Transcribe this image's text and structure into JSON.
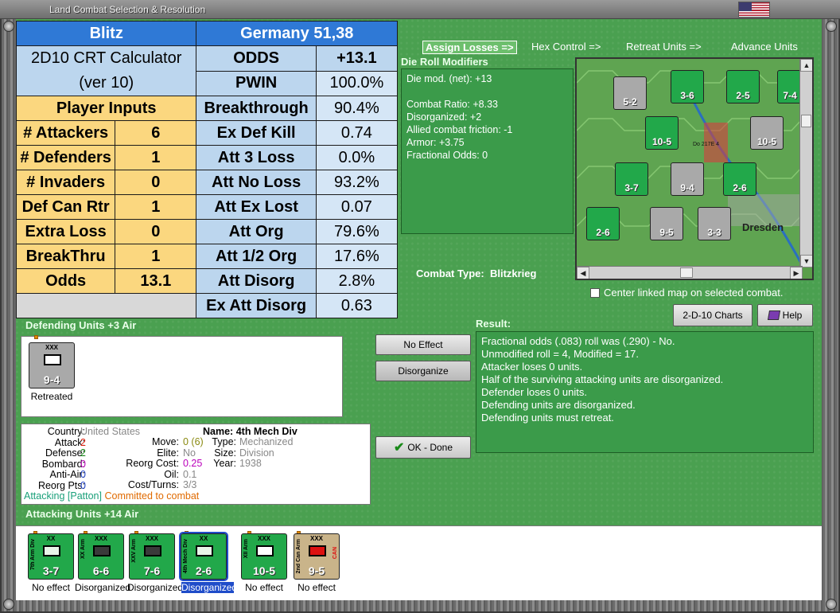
{
  "window": {
    "title": "Land Combat Selection & Resolution"
  },
  "calc": {
    "title": "Blitz",
    "location": "Germany 51,38",
    "calculator_line1": "2D10 CRT Calculator",
    "calculator_line2": "(ver 10)",
    "player_inputs": "Player Inputs",
    "inputs": [
      {
        "label": "# Attackers",
        "value": "6"
      },
      {
        "label": "# Defenders",
        "value": "1"
      },
      {
        "label": "# Invaders",
        "value": "0"
      },
      {
        "label": "Def Can Rtr",
        "value": "1"
      },
      {
        "label": "Extra Loss",
        "value": "0"
      },
      {
        "label": "BreakThru",
        "value": "1"
      },
      {
        "label": "Odds",
        "value": "13.1"
      }
    ],
    "results": [
      {
        "label": "ODDS",
        "value": "+13.1"
      },
      {
        "label": "PWIN",
        "value": "100.0%"
      },
      {
        "label": "Breakthrough",
        "value": "90.4%"
      },
      {
        "label": "Ex Def Kill",
        "value": "0.74"
      },
      {
        "label": "Att 3 Loss",
        "value": "0.0%"
      },
      {
        "label": "Att No Loss",
        "value": "93.2%"
      },
      {
        "label": "Att Ex Lost",
        "value": "0.07"
      },
      {
        "label": "Att Org",
        "value": "79.6%"
      },
      {
        "label": "Att 1/2 Org",
        "value": "17.6%"
      },
      {
        "label": "Att Disorg",
        "value": "2.8%"
      },
      {
        "label": "Ex Att Disorg",
        "value": "0.63"
      }
    ]
  },
  "nav": {
    "assign_losses": "Assign Losses =>",
    "hex_control": "Hex Control =>",
    "retreat_units": "Retreat Units =>",
    "advance_units": "Advance Units"
  },
  "die_roll": {
    "header": "Die Roll Modifiers",
    "lines": [
      "Die mod. (net): +13",
      "",
      "Combat Ratio: +8.33",
      "Disorganized: +2",
      "Allied combat friction: -1",
      "Armor: +3.75",
      "Fractional Odds: 0"
    ]
  },
  "map": {
    "city_label": "Dresden",
    "units": [
      {
        "strength": "5-2",
        "color": "#a9a9a9"
      },
      {
        "strength": "3-6",
        "color": "#22a84a"
      },
      {
        "strength": "2-5",
        "color": "#22a84a"
      },
      {
        "strength": "7-4",
        "color": "#22a84a"
      },
      {
        "strength": "10-5",
        "color": "#22a84a"
      },
      {
        "strength": "10-5",
        "color": "#a9a9a9"
      },
      {
        "strength": "3-7",
        "color": "#22a84a"
      },
      {
        "strength": "9-4",
        "color": "#a9a9a9"
      },
      {
        "strength": "2-6",
        "color": "#22a84a"
      },
      {
        "strength": "2-6",
        "color": "#22a84a"
      },
      {
        "strength": "9-5",
        "color": "#a9a9a9"
      },
      {
        "strength": "3-3",
        "color": "#a9a9a9"
      }
    ],
    "aircraft_label": "Do 217E 4"
  },
  "combat_type": {
    "label": "Combat Type:",
    "value": "Blitzkrieg"
  },
  "center_linked": "Center linked map on selected combat.",
  "buttons": {
    "charts": "2-D-10 Charts",
    "help": "Help",
    "no_effect": "No Effect",
    "disorganize": "Disorganize",
    "ok_done": "OK - Done"
  },
  "defending": {
    "header": "Defending Units +3 Air",
    "units": [
      {
        "strength": "9-4",
        "caption": "Retreated",
        "size": "XXX"
      }
    ]
  },
  "result": {
    "header": "Result:",
    "lines": [
      "Fractional odds (.083) roll was (.290)  - No.",
      "Unmodified roll = 4, Modified = 17.",
      "Attacker loses 0 units.",
      "Half of the surviving attacking units are disorganized.",
      "Defender loses 0 units.",
      "Defending units are disorganized.",
      "Defending units must retreat."
    ]
  },
  "unit_info": {
    "country_label": "Country:",
    "country": "United States",
    "attack_label": "Attack:",
    "attack": "2",
    "defense_label": "Defense:",
    "defense": "2",
    "bombard_label": "Bombard:",
    "bombard": "0",
    "antiair_label": "Anti-Air:",
    "antiair": "0",
    "reorg_label": "Reorg Pts:",
    "reorg": "0",
    "name_label": "Name:",
    "name": "4th Mech Div",
    "move_label": "Move:",
    "move": "0 (6)",
    "type_label": "Type:",
    "type": "Mechanized",
    "elite_label": "Elite:",
    "elite": "No",
    "size_label": "Size:",
    "size": "Division",
    "reorgcost_label": "Reorg Cost:",
    "reorgcost": "0.25",
    "year_label": "Year:",
    "year": "1938",
    "oil_label": "Oil:",
    "oil": "0.1",
    "costturns_label": "Cost/Turns:",
    "costturns": "3/3",
    "status_attacking": "Attacking [Patton]",
    "status_committed": "Committed to combat"
  },
  "attacking": {
    "header": "Attacking Units +14 Air",
    "units": [
      {
        "strength": "3-7",
        "caption": "No effect",
        "size": "XX",
        "name": "7th Arm Div",
        "color": "#22a84a"
      },
      {
        "strength": "6-6",
        "caption": "Disorganized",
        "size": "XXX",
        "name": "XX Arm",
        "color": "#22a84a"
      },
      {
        "strength": "7-6",
        "caption": "Disorganized",
        "size": "XXX",
        "name": "XXV Arm",
        "color": "#22a84a"
      },
      {
        "strength": "2-6",
        "caption": "Disorganized",
        "size": "XX",
        "name": "4th Mech Div",
        "color": "#22a84a"
      },
      {
        "strength": "10-5",
        "caption": "No effect",
        "size": "XXX",
        "name": "XII Arm",
        "color": "#22a84a"
      },
      {
        "strength": "9-5",
        "caption": "No effect",
        "size": "XXX",
        "name": "2nd Can Arm",
        "color": "#c9b48a"
      }
    ],
    "can_label": "CAN"
  }
}
